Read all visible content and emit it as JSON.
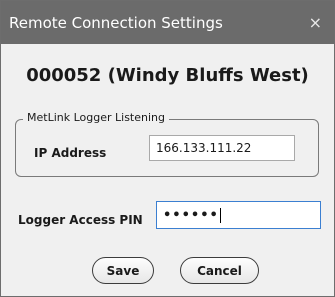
{
  "window": {
    "title": "Remote Connection Settings",
    "close_glyph": "×"
  },
  "site": {
    "heading": "000052 (Windy Bluffs West)"
  },
  "listening": {
    "group_label": "MetLink Logger Listening",
    "ip_label": "IP Address",
    "ip_value": "166.133.111.22"
  },
  "pin": {
    "label": "Logger Access PIN",
    "masked_value": "••••••"
  },
  "buttons": {
    "save_label": "Save",
    "cancel_label": "Cancel"
  }
}
